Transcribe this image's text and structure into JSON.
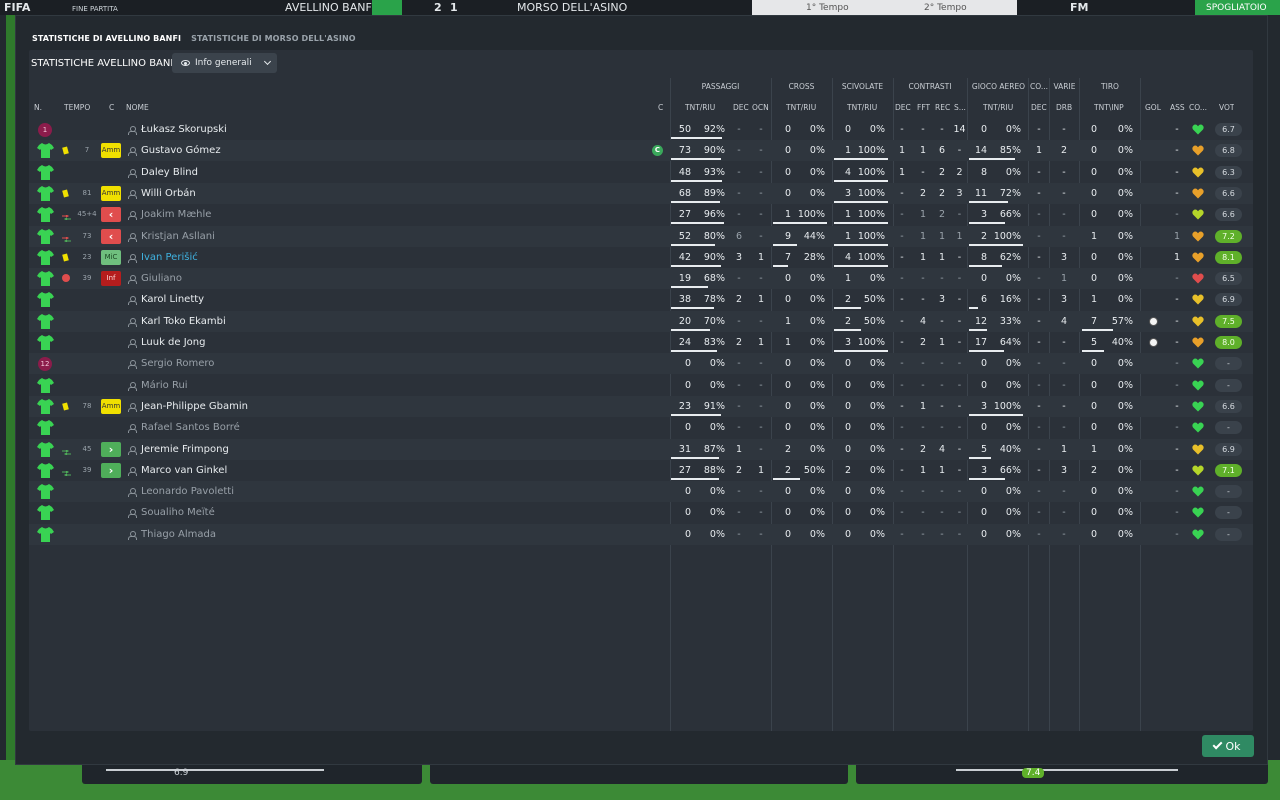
{
  "topbar": {
    "logo": "FIFA",
    "status": "FINE PARTITA",
    "home_team": "AVELLINO BANFI",
    "score_home": "2",
    "score_away": "1",
    "away_team": "MORSO DELL'ASINO",
    "half1": "1° Tempo",
    "half2": "2° Tempo",
    "fm": "FM",
    "dressing_room": "SPOGLIATOIO"
  },
  "dialog": {
    "tabs": [
      {
        "label": "STATISTICHE DI AVELLINO BANFI"
      },
      {
        "label": "STATISTICHE DI MORSO DELL'ASINO"
      }
    ],
    "panel_title": "STATISTICHE AVELLINO BANFI",
    "view_select": "Info generali",
    "ok_label": "Ok"
  },
  "colors": {
    "accent": "#2f8a63",
    "highlight_name": "#3fb2e0",
    "yellow_card": "#f0e000",
    "good_vote": "#5fb02a"
  },
  "groups": {
    "passaggi": "PASSAGGI",
    "cross": "CROSS",
    "scivolate": "SCIVOLATE",
    "contrasti": "CONTRASTI",
    "gioco_aereo": "GIOCO AEREO",
    "co": "CO...",
    "varie": "VARIE",
    "tiro": "TIRO"
  },
  "headers": {
    "n": "N.",
    "tempo": "TEMPO",
    "c": "C",
    "nome": "NOME",
    "c2": "C",
    "pass_tnt": "TNT/RIU",
    "pass_dec": "DEC",
    "pass_ocn": "OCN",
    "cross_tnt": "TNT/RIU",
    "sciv_tnt": "TNT/RIU",
    "cont_dec": "DEC",
    "cont_fft": "FFT",
    "cont_rec": "REC",
    "cont_s": "S...",
    "aer_tnt": "TNT/RIU",
    "co_dec": "DEC",
    "varie_drb": "DRB",
    "tiro_tnt": "TNT\\INP",
    "gol": "GOL",
    "ass": "ASS",
    "co2": "CO...",
    "vot": "VOT"
  },
  "players": [
    {
      "n": "1",
      "gk": true,
      "yc": false,
      "min": "",
      "badge": "",
      "name": "Łukasz Skorupski",
      "dim": false,
      "blue": false,
      "cap": false,
      "pt": "50",
      "pp": "92%",
      "pdec": "-",
      "pocn": "-",
      "ct": "0",
      "cp": "0%",
      "st": "0",
      "sp": "0%",
      "kdec": "-",
      "kfft": "-",
      "krec": "-",
      "ks": "14",
      "at": "0",
      "ap": "0%",
      "codec": "-",
      "drb": "-",
      "tt": "0",
      "tp": "0%",
      "gol": "",
      "ass": "-",
      "heart": "#39d353",
      "vote": "6.7",
      "good": false
    },
    {
      "n": "",
      "gk": false,
      "yc": true,
      "min": "7",
      "badge": "Amm",
      "name": "Gustavo Gómez",
      "dim": false,
      "blue": false,
      "cap": true,
      "pt": "73",
      "pp": "90%",
      "pdec": "-",
      "pocn": "-",
      "ct": "0",
      "cp": "0%",
      "st": "1",
      "sp": "100%",
      "kdec": "1",
      "kfft": "1",
      "krec": "6",
      "ks": "-",
      "at": "14",
      "ap": "85%",
      "codec": "1",
      "drb": "2",
      "tt": "0",
      "tp": "0%",
      "gol": "",
      "ass": "-",
      "heart": "#e8a02a",
      "vote": "6.8",
      "good": false
    },
    {
      "n": "",
      "gk": false,
      "yc": false,
      "min": "",
      "badge": "",
      "name": "Daley Blind",
      "dim": false,
      "blue": false,
      "cap": false,
      "pt": "48",
      "pp": "93%",
      "pdec": "-",
      "pocn": "-",
      "ct": "0",
      "cp": "0%",
      "st": "4",
      "sp": "100%",
      "kdec": "1",
      "kfft": "-",
      "krec": "2",
      "ks": "2",
      "at": "8",
      "ap": "0%",
      "codec": "-",
      "drb": "-",
      "tt": "0",
      "tp": "0%",
      "gol": "",
      "ass": "-",
      "heart": "#e8c02a",
      "vote": "6.3",
      "good": false
    },
    {
      "n": "",
      "gk": false,
      "yc": true,
      "min": "81",
      "badge": "Amm",
      "name": "Willi Orbán",
      "dim": false,
      "blue": false,
      "cap": false,
      "pt": "68",
      "pp": "89%",
      "pdec": "-",
      "pocn": "-",
      "ct": "0",
      "cp": "0%",
      "st": "3",
      "sp": "100%",
      "kdec": "-",
      "kfft": "2",
      "krec": "2",
      "ks": "3",
      "at": "11",
      "ap": "72%",
      "codec": "-",
      "drb": "-",
      "tt": "0",
      "tp": "0%",
      "gol": "",
      "ass": "-",
      "heart": "#e8a02a",
      "vote": "6.6",
      "good": false
    },
    {
      "n": "",
      "gk": false,
      "yc": false,
      "sub": "out",
      "min": "45+4",
      "badge": "out",
      "name": "Joakim Mæhle",
      "dim": true,
      "blue": false,
      "cap": false,
      "pt": "27",
      "pp": "96%",
      "pdec": "-",
      "pocn": "-",
      "ct": "1",
      "cp": "100%",
      "st": "1",
      "sp": "100%",
      "kdec": "-",
      "kfft": "1",
      "krec": "2",
      "ks": "-",
      "at": "3",
      "ap": "66%",
      "codec": "-",
      "drb": "-",
      "tt": "0",
      "tp": "0%",
      "gol": "",
      "ass": "-",
      "heart": "#b5d62a",
      "vote": "6.6",
      "good": false
    },
    {
      "n": "",
      "gk": false,
      "yc": false,
      "sub": "out",
      "min": "73",
      "badge": "out",
      "name": "Kristjan Asllani",
      "dim": true,
      "blue": false,
      "cap": false,
      "pt": "52",
      "pp": "80%",
      "pdec": "6",
      "pocn": "-",
      "ct": "9",
      "cp": "44%",
      "st": "1",
      "sp": "100%",
      "kdec": "-",
      "kfft": "1",
      "krec": "1",
      "ks": "1",
      "at": "2",
      "ap": "100%",
      "codec": "-",
      "drb": "-",
      "tt": "1",
      "tp": "0%",
      "gol": "",
      "ass": "1",
      "heart": "#e8a02a",
      "vote": "7.2",
      "good": true
    },
    {
      "n": "",
      "gk": false,
      "yc": true,
      "min": "23",
      "badge": "MiC",
      "name": "Ivan Perišić",
      "dim": false,
      "blue": true,
      "cap": false,
      "pt": "42",
      "pp": "90%",
      "pdec": "3",
      "pocn": "1",
      "ct": "7",
      "cp": "28%",
      "st": "4",
      "sp": "100%",
      "kdec": "-",
      "kfft": "1",
      "krec": "1",
      "ks": "-",
      "at": "8",
      "ap": "62%",
      "codec": "-",
      "drb": "3",
      "tt": "0",
      "tp": "0%",
      "gol": "",
      "ass": "1",
      "heart": "#e8a02a",
      "vote": "8.1",
      "good": true
    },
    {
      "n": "",
      "gk": false,
      "yc": false,
      "inj": true,
      "min": "39",
      "badge": "Inf",
      "name": "Giuliano",
      "dim": true,
      "blue": false,
      "cap": false,
      "pt": "19",
      "pp": "68%",
      "pdec": "-",
      "pocn": "-",
      "ct": "0",
      "cp": "0%",
      "st": "1",
      "sp": "0%",
      "kdec": "-",
      "kfft": "-",
      "krec": "-",
      "ks": "-",
      "at": "0",
      "ap": "0%",
      "codec": "-",
      "drb": "1",
      "tt": "0",
      "tp": "0%",
      "gol": "",
      "ass": "-",
      "heart": "#e04d4d",
      "vote": "6.5",
      "good": false
    },
    {
      "n": "",
      "gk": false,
      "yc": false,
      "min": "",
      "badge": "",
      "name": "Karol Linetty",
      "dim": false,
      "blue": false,
      "cap": false,
      "pt": "38",
      "pp": "78%",
      "pdec": "2",
      "pocn": "1",
      "ct": "0",
      "cp": "0%",
      "st": "2",
      "sp": "50%",
      "kdec": "-",
      "kfft": "-",
      "krec": "3",
      "ks": "-",
      "at": "6",
      "ap": "16%",
      "codec": "-",
      "drb": "3",
      "tt": "1",
      "tp": "0%",
      "gol": "",
      "ass": "-",
      "heart": "#e8c02a",
      "vote": "6.9",
      "good": false
    },
    {
      "n": "",
      "gk": false,
      "yc": false,
      "min": "",
      "badge": "",
      "name": "Karl Toko Ekambi",
      "dim": false,
      "blue": false,
      "cap": false,
      "pt": "20",
      "pp": "70%",
      "pdec": "-",
      "pocn": "-",
      "ct": "1",
      "cp": "0%",
      "st": "2",
      "sp": "50%",
      "kdec": "-",
      "kfft": "4",
      "krec": "-",
      "ks": "-",
      "at": "12",
      "ap": "33%",
      "codec": "-",
      "drb": "4",
      "tt": "7",
      "tp": "57%",
      "gol": "ball",
      "ass": "-",
      "heart": "#e8c02a",
      "vote": "7.5",
      "good": true
    },
    {
      "n": "",
      "gk": false,
      "yc": false,
      "min": "",
      "badge": "",
      "name": "Luuk de Jong",
      "dim": false,
      "blue": false,
      "cap": false,
      "pt": "24",
      "pp": "83%",
      "pdec": "2",
      "pocn": "1",
      "ct": "1",
      "cp": "0%",
      "st": "3",
      "sp": "100%",
      "kdec": "-",
      "kfft": "2",
      "krec": "1",
      "ks": "-",
      "at": "17",
      "ap": "64%",
      "codec": "-",
      "drb": "-",
      "tt": "5",
      "tp": "40%",
      "gol": "ball",
      "ass": "-",
      "heart": "#e8a02a",
      "vote": "8.0",
      "good": true
    },
    {
      "n": "12",
      "gk": true,
      "yc": false,
      "min": "",
      "badge": "",
      "name": "Sergio Romero",
      "dim": true,
      "blue": false,
      "cap": false,
      "pt": "0",
      "pp": "0%",
      "pdec": "-",
      "pocn": "-",
      "ct": "0",
      "cp": "0%",
      "st": "0",
      "sp": "0%",
      "kdec": "-",
      "kfft": "-",
      "krec": "-",
      "ks": "-",
      "at": "0",
      "ap": "0%",
      "codec": "-",
      "drb": "-",
      "tt": "0",
      "tp": "0%",
      "gol": "",
      "ass": "-",
      "heart": "#39d353",
      "vote": "-",
      "good": false
    },
    {
      "n": "",
      "gk": false,
      "yc": false,
      "min": "",
      "badge": "",
      "name": "Mário Rui",
      "dim": true,
      "blue": false,
      "cap": false,
      "pt": "0",
      "pp": "0%",
      "pdec": "-",
      "pocn": "-",
      "ct": "0",
      "cp": "0%",
      "st": "0",
      "sp": "0%",
      "kdec": "-",
      "kfft": "-",
      "krec": "-",
      "ks": "-",
      "at": "0",
      "ap": "0%",
      "codec": "-",
      "drb": "-",
      "tt": "0",
      "tp": "0%",
      "gol": "",
      "ass": "-",
      "heart": "#39d353",
      "vote": "-",
      "good": false
    },
    {
      "n": "",
      "gk": false,
      "yc": true,
      "min": "78",
      "badge": "Amm",
      "name": "Jean-Philippe Gbamin",
      "dim": false,
      "blue": false,
      "cap": false,
      "pt": "23",
      "pp": "91%",
      "pdec": "-",
      "pocn": "-",
      "ct": "0",
      "cp": "0%",
      "st": "0",
      "sp": "0%",
      "kdec": "-",
      "kfft": "1",
      "krec": "-",
      "ks": "-",
      "at": "3",
      "ap": "100%",
      "codec": "-",
      "drb": "-",
      "tt": "0",
      "tp": "0%",
      "gol": "",
      "ass": "-",
      "heart": "#39d353",
      "vote": "6.6",
      "good": false
    },
    {
      "n": "",
      "gk": false,
      "yc": false,
      "min": "",
      "badge": "",
      "name": "Rafael Santos Borré",
      "dim": true,
      "blue": false,
      "cap": false,
      "pt": "0",
      "pp": "0%",
      "pdec": "-",
      "pocn": "-",
      "ct": "0",
      "cp": "0%",
      "st": "0",
      "sp": "0%",
      "kdec": "-",
      "kfft": "-",
      "krec": "-",
      "ks": "-",
      "at": "0",
      "ap": "0%",
      "codec": "-",
      "drb": "-",
      "tt": "0",
      "tp": "0%",
      "gol": "",
      "ass": "-",
      "heart": "#39d353",
      "vote": "-",
      "good": false
    },
    {
      "n": "",
      "gk": false,
      "yc": false,
      "sub": "in",
      "min": "45",
      "badge": "in",
      "name": "Jeremie Frimpong",
      "dim": false,
      "blue": false,
      "cap": false,
      "pt": "31",
      "pp": "87%",
      "pdec": "1",
      "pocn": "-",
      "ct": "2",
      "cp": "0%",
      "st": "0",
      "sp": "0%",
      "kdec": "-",
      "kfft": "2",
      "krec": "4",
      "ks": "-",
      "at": "5",
      "ap": "40%",
      "codec": "-",
      "drb": "1",
      "tt": "1",
      "tp": "0%",
      "gol": "",
      "ass": "-",
      "heart": "#e8c02a",
      "vote": "6.9",
      "good": false
    },
    {
      "n": "",
      "gk": false,
      "yc": false,
      "sub": "in",
      "min": "39",
      "badge": "in",
      "name": "Marco van Ginkel",
      "dim": false,
      "blue": false,
      "cap": false,
      "pt": "27",
      "pp": "88%",
      "pdec": "2",
      "pocn": "1",
      "ct": "2",
      "cp": "50%",
      "st": "2",
      "sp": "0%",
      "kdec": "-",
      "kfft": "1",
      "krec": "1",
      "ks": "-",
      "at": "3",
      "ap": "66%",
      "codec": "-",
      "drb": "3",
      "tt": "2",
      "tp": "0%",
      "gol": "",
      "ass": "-",
      "heart": "#b5d62a",
      "vote": "7.1",
      "good": true
    },
    {
      "n": "",
      "gk": false,
      "yc": false,
      "min": "",
      "badge": "",
      "name": "Leonardo Pavoletti",
      "dim": true,
      "blue": false,
      "cap": false,
      "pt": "0",
      "pp": "0%",
      "pdec": "-",
      "pocn": "-",
      "ct": "0",
      "cp": "0%",
      "st": "0",
      "sp": "0%",
      "kdec": "-",
      "kfft": "-",
      "krec": "-",
      "ks": "-",
      "at": "0",
      "ap": "0%",
      "codec": "-",
      "drb": "-",
      "tt": "0",
      "tp": "0%",
      "gol": "",
      "ass": "-",
      "heart": "#39d353",
      "vote": "-",
      "good": false
    },
    {
      "n": "",
      "gk": false,
      "yc": false,
      "min": "",
      "badge": "",
      "name": "Soualiho Meïté",
      "dim": true,
      "blue": false,
      "cap": false,
      "pt": "0",
      "pp": "0%",
      "pdec": "-",
      "pocn": "-",
      "ct": "0",
      "cp": "0%",
      "st": "0",
      "sp": "0%",
      "kdec": "-",
      "kfft": "-",
      "krec": "-",
      "ks": "-",
      "at": "0",
      "ap": "0%",
      "codec": "-",
      "drb": "-",
      "tt": "0",
      "tp": "0%",
      "gol": "",
      "ass": "-",
      "heart": "#39d353",
      "vote": "-",
      "good": false
    },
    {
      "n": "",
      "gk": false,
      "yc": false,
      "min": "",
      "badge": "",
      "name": "Thiago Almada",
      "dim": true,
      "blue": false,
      "cap": false,
      "pt": "0",
      "pp": "0%",
      "pdec": "-",
      "pocn": "-",
      "ct": "0",
      "cp": "0%",
      "st": "0",
      "sp": "0%",
      "kdec": "-",
      "kfft": "-",
      "krec": "-",
      "ks": "-",
      "at": "0",
      "ap": "0%",
      "codec": "-",
      "drb": "-",
      "tt": "0",
      "tp": "0%",
      "gol": "",
      "ass": "-",
      "heart": "#39d353",
      "vote": "-",
      "good": false
    }
  ],
  "bottom": {
    "left_vote": "6.9",
    "right_vote": "7.4"
  }
}
